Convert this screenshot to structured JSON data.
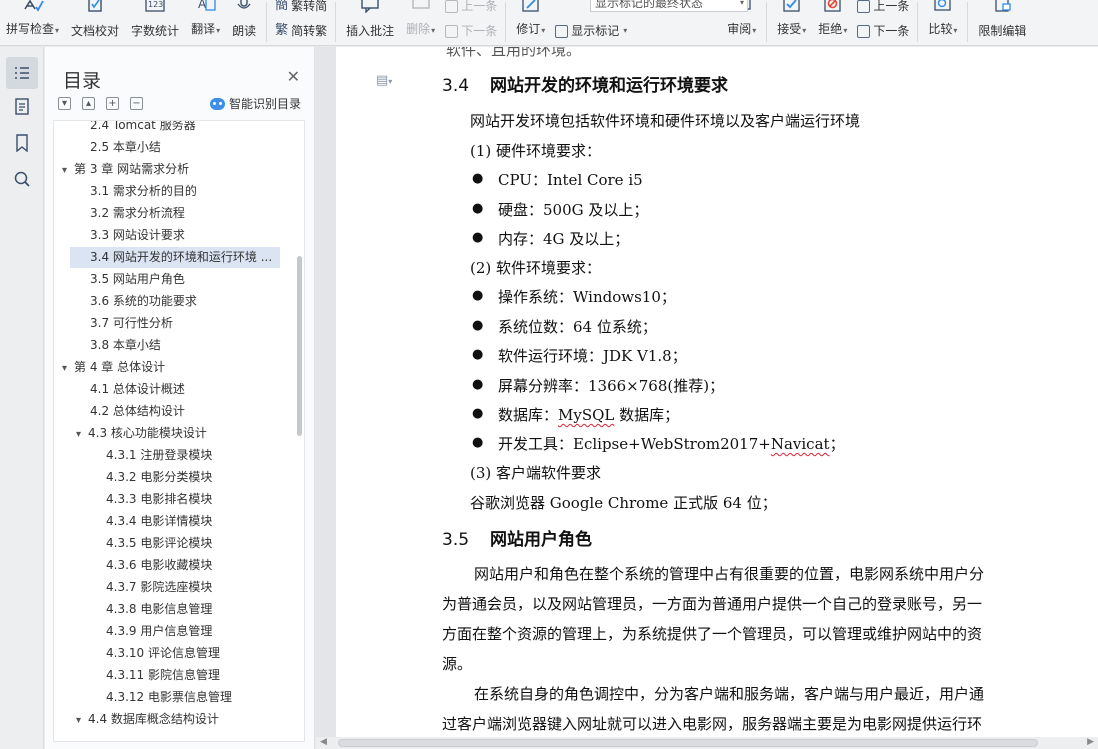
{
  "ribbon": {
    "spell_check": "拼写检查",
    "doc_proofread": "文档校对",
    "word_count": "字数统计",
    "translate": "翻译",
    "read_aloud": "朗读",
    "trad_to_simp": "繁转简",
    "simp_to_trad": "简转繁",
    "insert_comment": "插入批注",
    "delete": "删除",
    "prev": "上一条",
    "next": "下一条",
    "revise": "修订",
    "markup_state": "显示标记的最终状态",
    "show_markup": "显示标记",
    "review": "审阅",
    "accept": "接受",
    "reject": "拒绝",
    "prev2": "上一条",
    "next2": "下一条",
    "compare": "比较",
    "restrict_edit": "限制编辑"
  },
  "toc": {
    "title": "目录",
    "smart_toc": "智能识别目录",
    "items": [
      {
        "text": "2.4 Tomcat 服务器",
        "level": 2
      },
      {
        "text": "2.5 本章小结",
        "level": 2
      },
      {
        "text": "第 3 章 网站需求分析",
        "level": 1,
        "expanded": true
      },
      {
        "text": "3.1 需求分析的目的",
        "level": 2
      },
      {
        "text": "3.2 需求分析流程",
        "level": 2
      },
      {
        "text": "3.3 网站设计要求",
        "level": 2
      },
      {
        "text": "3.4 网站开发的环境和运行环境 ...",
        "level": 2,
        "selected": true
      },
      {
        "text": "3.5 网站用户角色",
        "level": 2
      },
      {
        "text": "3.6 系统的功能要求",
        "level": 2
      },
      {
        "text": "3.7 可行性分析",
        "level": 2
      },
      {
        "text": "3.8 本章小结",
        "level": 2
      },
      {
        "text": "第 4 章 总体设计",
        "level": 1,
        "expanded": true
      },
      {
        "text": "4.1 总体设计概述",
        "level": 2
      },
      {
        "text": "4.2 总体结构设计",
        "level": 2
      },
      {
        "text": "4.3 核心功能模块设计",
        "level": 2,
        "expanded": true
      },
      {
        "text": "4.3.1 注册登录模块",
        "level": 3
      },
      {
        "text": "4.3.2 电影分类模块",
        "level": 3
      },
      {
        "text": "4.3.3 电影排名模块",
        "level": 3
      },
      {
        "text": "4.3.4 电影详情模块",
        "level": 3
      },
      {
        "text": "4.3.5 电影评论模块",
        "level": 3
      },
      {
        "text": "4.3.6 电影收藏模块",
        "level": 3
      },
      {
        "text": "4.3.7 影院选座模块",
        "level": 3
      },
      {
        "text": "4.3.8 电影信息管理",
        "level": 3
      },
      {
        "text": "4.3.9 用户信息管理",
        "level": 3
      },
      {
        "text": "4.3.10 评论信息管理",
        "level": 3
      },
      {
        "text": "4.3.11 影院信息管理",
        "level": 3
      },
      {
        "text": "4.3.12 电影票信息管理",
        "level": 3
      },
      {
        "text": "4.4 数据库概念结构设计",
        "level": 2,
        "expanded": true
      }
    ]
  },
  "doc": {
    "top_cut": "软件、且用的环境。",
    "h34_num": "3.4",
    "h34_title": "网站开发的环境和运行环境要求",
    "intro": "网站开发环境包括软件环境和硬件环境以及客户端运行环境",
    "hw_req": "(1)  硬件环境要求：",
    "cpu": "CPU：Intel Core i5",
    "disk": "硬盘：500G 及以上；",
    "mem": "内存：4G 及以上；",
    "sw_req": "(2)  软件环境要求：",
    "os": "操作系统：Windows10；",
    "bits": "系统位数：64 位系统；",
    "runtime": "软件运行环境：JDK V1.8；",
    "resolution": "屏幕分辨率：1366×768(推荐)；",
    "db_pre": "数据库：",
    "db_mysql": "MySQL",
    "db_post": " 数据库；",
    "tools_pre": "开发工具：Eclipse+WebStrom2017+",
    "tools_navicat": "Navicat",
    "tools_post": "；",
    "client_req": "(3)  客户端软件要求",
    "browser": "谷歌浏览器  Google Chrome 正式版 64 位；",
    "h35_num": "3.5",
    "h35_title": "网站用户角色",
    "p1_l1": "网站用户和角色在整个系统的管理中占有很重要的位置，电影网系统中用户分",
    "p1_l2": "为普通会员，以及网站管理员，一方面为普通用户提供一个自己的登录账号，另一",
    "p1_l3": "方面在整个资源的管理上，为系统提供了一个管理员，可以管理或维护网站中的资",
    "p1_l4": "源。",
    "p2_l1": "在系统自身的角色调控中，分为客户端和服务端，客户端与用户最近，用户通",
    "p2_l2": "过客户端浏览器键入网址就可以进入电影网，服务器端主要是为电影网提供运行环"
  }
}
